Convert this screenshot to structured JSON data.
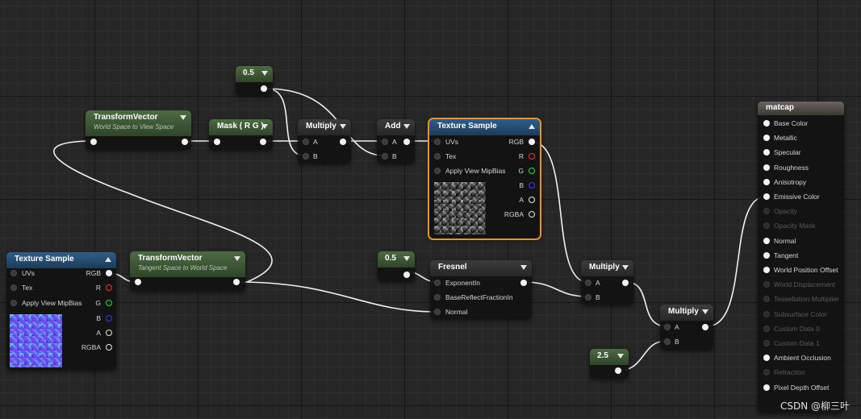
{
  "nodes": {
    "const_05_top": {
      "value": "0.5"
    },
    "transform_vector_1": {
      "title": "TransformVector",
      "subtitle": "World Space to View Space"
    },
    "mask": {
      "title": "Mask ( R G )"
    },
    "multiply_1": {
      "title": "Multiply",
      "inputs": [
        "A",
        "B"
      ]
    },
    "add": {
      "title": "Add",
      "inputs": [
        "A",
        "B"
      ]
    },
    "texture_sample_top": {
      "title": "Texture Sample",
      "inputs": [
        "UVs",
        "Tex",
        "Apply View MipBias"
      ],
      "outputs": [
        "RGB",
        "R",
        "G",
        "B",
        "A",
        "RGBA"
      ]
    },
    "texture_sample_left": {
      "title": "Texture Sample",
      "inputs": [
        "UVs",
        "Tex",
        "Apply View MipBias"
      ],
      "outputs": [
        "RGB",
        "R",
        "G",
        "B",
        "A",
        "RGBA"
      ]
    },
    "transform_vector_2": {
      "title": "TransformVector",
      "subtitle": "Tangent Space to World Space"
    },
    "const_05_mid": {
      "value": "0.5"
    },
    "fresnel": {
      "title": "Fresnel",
      "inputs": [
        "ExponentIn",
        "BaseReflectFractionIn",
        "Normal"
      ]
    },
    "multiply_2": {
      "title": "Multiply",
      "inputs": [
        "A",
        "B"
      ]
    },
    "multiply_3": {
      "title": "Multiply",
      "inputs": [
        "A",
        "B"
      ]
    },
    "const_25": {
      "value": "2.5"
    },
    "material": {
      "title": "matcap",
      "inputs": [
        {
          "label": "Base Color",
          "enabled": true
        },
        {
          "label": "Metallic",
          "enabled": true
        },
        {
          "label": "Specular",
          "enabled": true
        },
        {
          "label": "Roughness",
          "enabled": true
        },
        {
          "label": "Anisotropy",
          "enabled": true
        },
        {
          "label": "Emissive Color",
          "enabled": true
        },
        {
          "label": "Opacity",
          "enabled": false
        },
        {
          "label": "Opacity Mask",
          "enabled": false
        },
        {
          "label": "Normal",
          "enabled": true
        },
        {
          "label": "Tangent",
          "enabled": true
        },
        {
          "label": "World Position Offset",
          "enabled": true
        },
        {
          "label": "World Displacement",
          "enabled": false
        },
        {
          "label": "Tessellation Multiplier",
          "enabled": false
        },
        {
          "label": "Subsurface Color",
          "enabled": false
        },
        {
          "label": "Custom Data 0",
          "enabled": false
        },
        {
          "label": "Custom Data 1",
          "enabled": false
        },
        {
          "label": "Ambient Occlusion",
          "enabled": true
        },
        {
          "label": "Refraction",
          "enabled": false
        },
        {
          "label": "Pixel Depth Offset",
          "enabled": true
        }
      ]
    }
  },
  "watermark": "CSDN @柳三叶",
  "colors": {
    "wire": "#ffffff",
    "selection": "#e8942a",
    "constant_header": "#4d6b43",
    "texture_header": "#2f5f8a"
  }
}
